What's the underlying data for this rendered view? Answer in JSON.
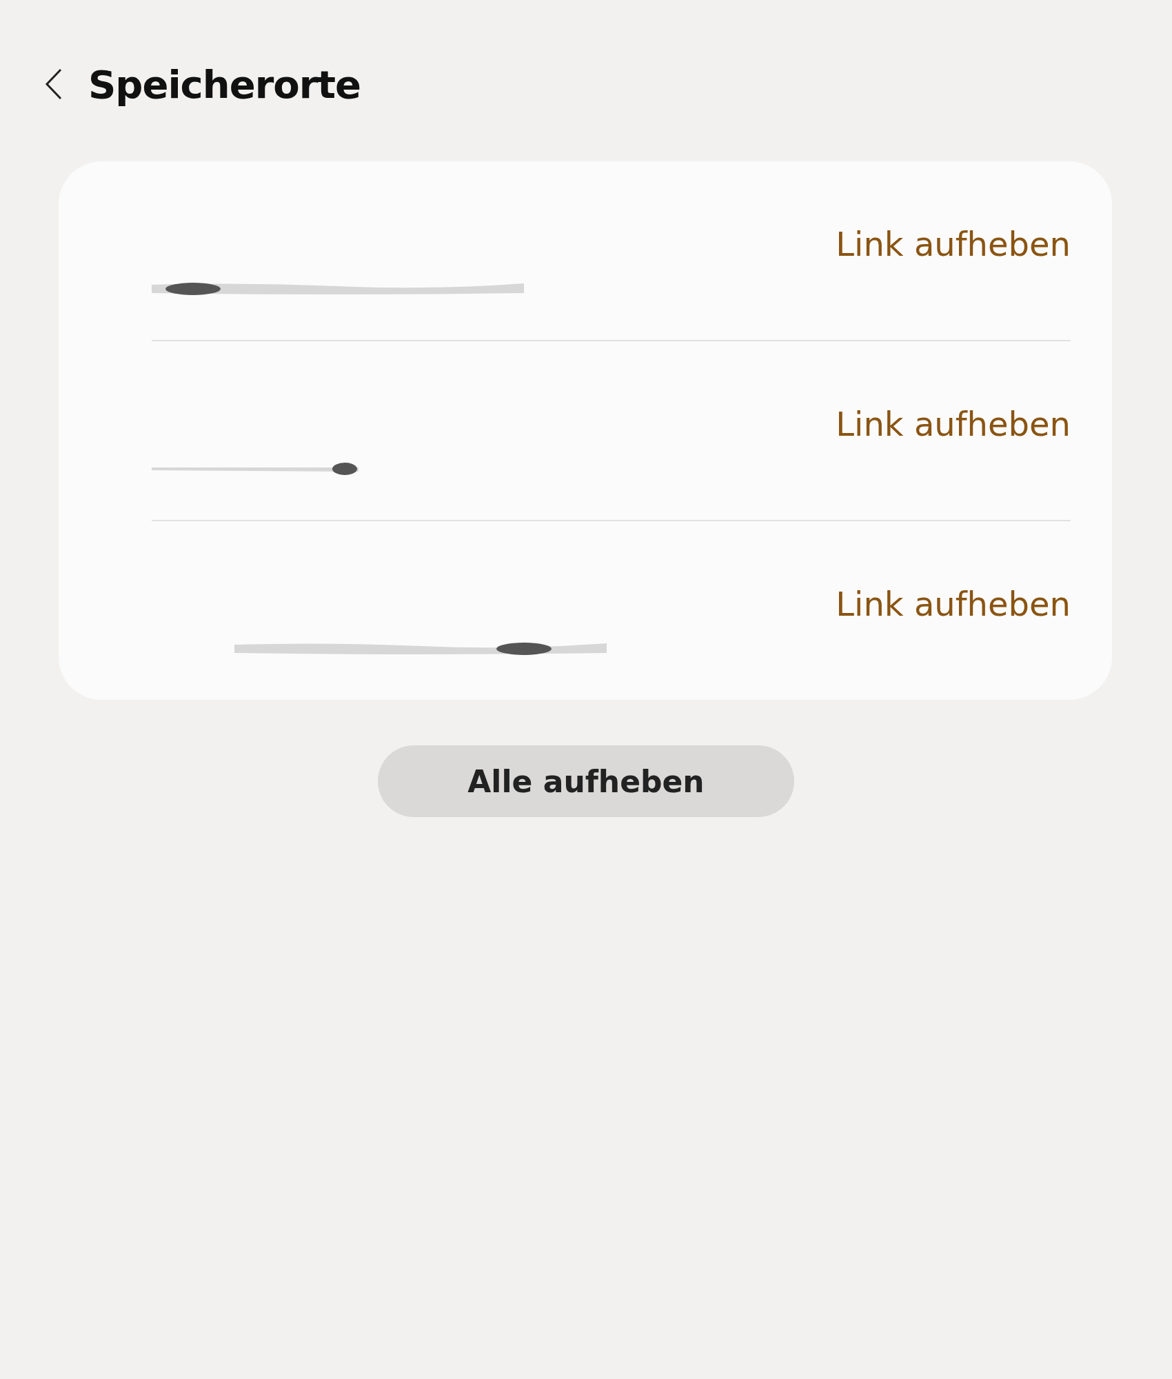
{
  "header": {
    "title": "Speicherorte"
  },
  "locations": [
    {
      "action": "Link aufheben"
    },
    {
      "action": "Link aufheben"
    },
    {
      "action": "Link aufheben"
    }
  ],
  "footer_button": "Alle aufheben"
}
